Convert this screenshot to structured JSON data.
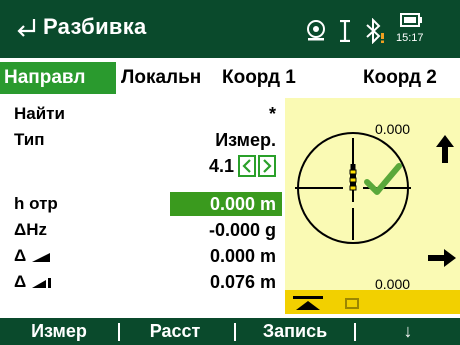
{
  "app": {
    "title": "Разбивка",
    "time": "15:17"
  },
  "tabs": [
    {
      "label": "Направл",
      "active": true
    },
    {
      "label": "Локальн",
      "active": false
    },
    {
      "label": "Коорд 1",
      "active": false
    },
    {
      "label": "Коорд 2",
      "active": false
    }
  ],
  "fields": {
    "find": {
      "label": "Найти",
      "value": "*"
    },
    "type": {
      "label": "Тип",
      "value": "Измер.",
      "stepper_value": "4.1"
    },
    "h_offset": {
      "label": "h отр",
      "value": "0.000 m"
    },
    "dhz": {
      "label": "ΔHz",
      "value": "-0.000 g"
    },
    "d_horiz": {
      "label": "Δ",
      "value": "0.000 m"
    },
    "d_vert": {
      "label": "Δ",
      "value": "0.076 m"
    }
  },
  "graphic": {
    "top_value": "0.000",
    "bottom_value": "0.000"
  },
  "softkeys": [
    {
      "label": "Измер"
    },
    {
      "label": "Расст"
    },
    {
      "label": "Запись"
    },
    {
      "label": "↓"
    }
  ],
  "colors": {
    "titlebar": "#0a4a2c",
    "accent_green": "#2a9a2e",
    "input_green": "#3a9a1e",
    "graphic_bg": "#fafab4"
  },
  "icons": [
    "back-arrow-icon",
    "prism-icon",
    "cursor-icon",
    "bluetooth-icon",
    "battery-icon",
    "arrow-up-icon",
    "arrow-right-icon",
    "check-icon",
    "reflector-icon"
  ]
}
